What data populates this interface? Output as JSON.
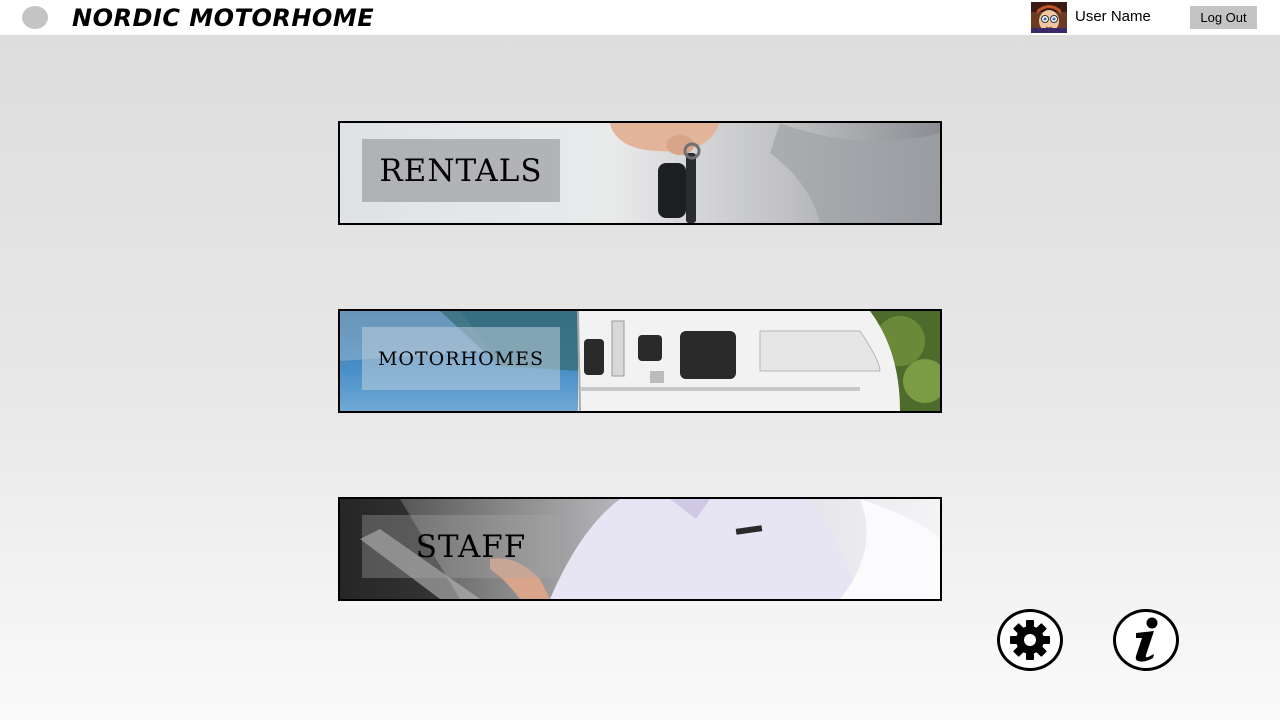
{
  "header": {
    "title": "NORDIC MOTORHOME",
    "menu_icon": "menu-dot-icon",
    "user_name": "User Name",
    "logout_label": "Log Out"
  },
  "menu": {
    "tiles": [
      {
        "label": "RENTALS",
        "image": "hand-with-car-keys"
      },
      {
        "label": "MOTORHOMES",
        "image": "white-motorhome-by-fjord"
      },
      {
        "label": "STAFF",
        "image": "staff-member-in-shirt"
      }
    ]
  },
  "footer": {
    "settings_icon": "gear-icon",
    "info_icon": "info-icon"
  },
  "colors": {
    "topbar": "#ffffff",
    "button_gray": "#c4c4c4",
    "border": "#000000"
  }
}
